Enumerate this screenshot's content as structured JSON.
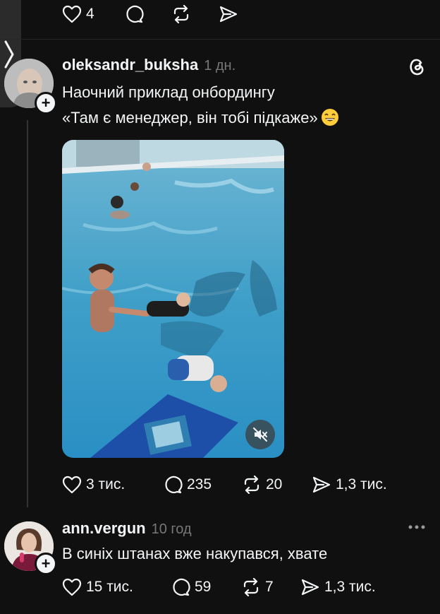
{
  "prev_post": {
    "actions": {
      "likes": "4"
    }
  },
  "post": {
    "username": "oleksandr_buksha",
    "time": "1 дн.",
    "text_line1": "Наочний приклад онбордингу",
    "text_line2": "«Там є менеджер, він тобі підкаже»",
    "emoji": "grinning-face-with-smiling-eyes-icon",
    "actions": {
      "likes": "3 тис.",
      "replies": "235",
      "reposts": "20",
      "shares": "1,3 тис."
    }
  },
  "reply": {
    "username": "ann.vergun",
    "time": "10 год",
    "text": "В синіх штанах вже накупався, хвате",
    "actions": {
      "likes": "15 тис.",
      "replies": "59",
      "reposts": "7",
      "shares": "1,3 тис."
    }
  },
  "colors": {
    "background": "#101010",
    "text": "#f3f5f7",
    "muted": "#777777",
    "divider": "#262626"
  }
}
